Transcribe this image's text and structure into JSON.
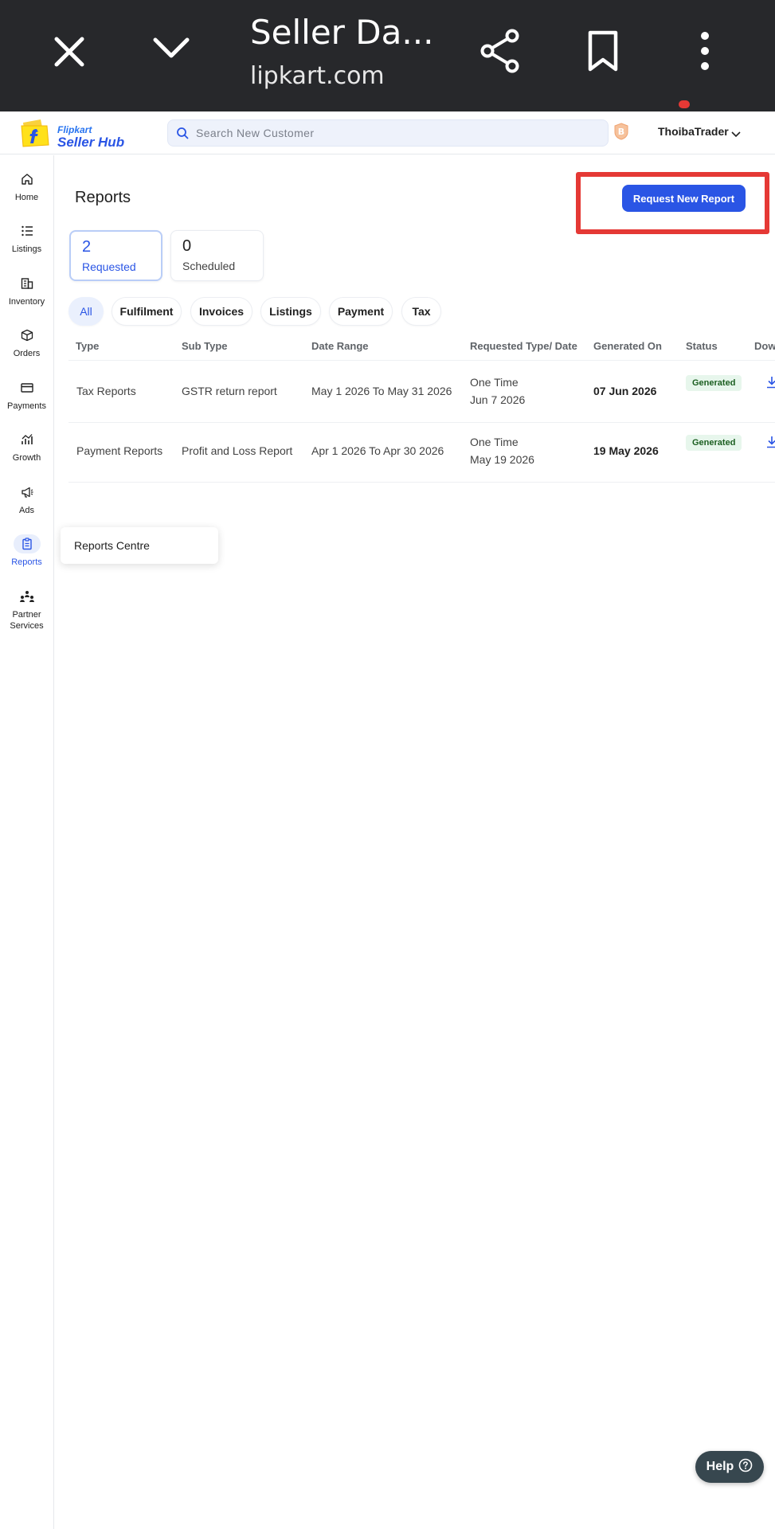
{
  "browser": {
    "title": "Seller Da...",
    "url": "lipkart.com",
    "icons": [
      "close-icon",
      "chevron-down-icon",
      "share-icon",
      "bookmark-icon",
      "more-vert-icon"
    ]
  },
  "header": {
    "brand_top": "Flipkart",
    "brand_bottom": "Seller Hub",
    "search_placeholder": "Search New Customer",
    "badge_letter": "B",
    "user_name": "ThoibaTrader"
  },
  "sidebar": {
    "items": [
      {
        "label": "Home",
        "icon": "home-icon"
      },
      {
        "label": "Listings",
        "icon": "list-icon"
      },
      {
        "label": "Inventory",
        "icon": "inventory-icon"
      },
      {
        "label": "Orders",
        "icon": "box-icon"
      },
      {
        "label": "Payments",
        "icon": "card-icon"
      },
      {
        "label": "Growth",
        "icon": "growth-icon"
      },
      {
        "label": "Ads",
        "icon": "megaphone-icon"
      },
      {
        "label": "Reports",
        "icon": "clipboard-icon",
        "active": true
      },
      {
        "label": "Partner Services",
        "icon": "partners-icon"
      }
    ]
  },
  "main": {
    "title": "Reports",
    "request_button": "Request New Report",
    "stats": [
      {
        "count": "2",
        "label": "Requested",
        "active": true
      },
      {
        "count": "0",
        "label": "Scheduled",
        "active": false
      }
    ],
    "filters": [
      "All",
      "Fulfilment",
      "Invoices",
      "Listings",
      "Payment",
      "Tax"
    ],
    "active_filter": "All",
    "table": {
      "headers": [
        "Type",
        "Sub Type",
        "Date Range",
        "Requested Type/ Date",
        "Generated On",
        "Status",
        "Dow"
      ],
      "rows": [
        {
          "type": "Tax Reports",
          "sub_type": "GSTR return report",
          "date_range": "May 1 2026 To May 31 2026",
          "req_type": "One Time",
          "req_date": "Jun 7 2026",
          "generated_on": "07 Jun 2026",
          "status": "Generated"
        },
        {
          "type": "Payment Reports",
          "sub_type": "Profit and Loss Report",
          "date_range": "Apr 1 2026 To Apr 30 2026",
          "req_type": "One Time",
          "req_date": "May 19 2026",
          "generated_on": "19 May 2026",
          "status": "Generated"
        }
      ]
    },
    "popup_item": "Reports Centre"
  },
  "help": {
    "label": "Help"
  },
  "colors": {
    "accent": "#2a55e5",
    "highlight": "#e53935",
    "chrome": "#27282b",
    "status_bg": "#e7f6ec"
  }
}
